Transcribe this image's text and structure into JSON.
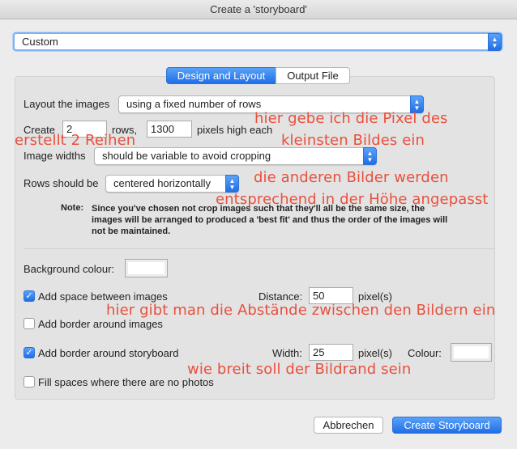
{
  "window": {
    "title": "Create a 'storyboard'"
  },
  "preset": {
    "value": "Custom"
  },
  "tabs": {
    "design": "Design and Layout",
    "output": "Output File"
  },
  "layout": {
    "label": "Layout the images",
    "value": "using a fixed number of rows",
    "create_label": "Create",
    "rows_value": "2",
    "rows_label": "rows,",
    "pixels_value": "1300",
    "pixels_label": "pixels high each",
    "widths_label": "Image widths",
    "widths_value": "should be variable to avoid cropping",
    "rows_should_label": "Rows should be",
    "rows_should_value": "centered horizontally",
    "note_label": "Note:",
    "note_text": "Since you've chosen not crop images such that they'll all be the same size, the images will be arranged to produced a 'best fit' and thus the order of the images will not be maintained."
  },
  "appearance": {
    "background_label": "Background colour:",
    "space_label": "Add space between images",
    "space_checked": true,
    "distance_label": "Distance:",
    "distance_value": "50",
    "distance_unit": "pixel(s)",
    "border_images_label": "Add border around images",
    "border_images_checked": false,
    "border_storyboard_label": "Add border around storyboard",
    "border_storyboard_checked": true,
    "width_label": "Width:",
    "width_value": "25",
    "width_unit": "pixel(s)",
    "colour_label": "Colour:",
    "fill_label": "Fill spaces where there are no photos",
    "fill_checked": false
  },
  "annotations": {
    "a1": "hier gebe ich die Pixel des",
    "a2": "kleinsten Bildes ein",
    "a3": "erstellt 2 Reihen",
    "a4": "die anderen Bilder werden",
    "a5": "entsprechend in der Höhe angepasst",
    "a6": "hier gibt man die Abstände zwischen den Bildern ein",
    "a7": "wie breit soll der Bildrand sein"
  },
  "buttons": {
    "cancel": "Abbrechen",
    "create": "Create Storyboard"
  },
  "colors": {
    "accent": "#1f6fe8",
    "annotation": "#e8503d"
  },
  "icons": {
    "popup_arrows": "up-down-chevron-icon",
    "check": "checkmark-icon"
  }
}
